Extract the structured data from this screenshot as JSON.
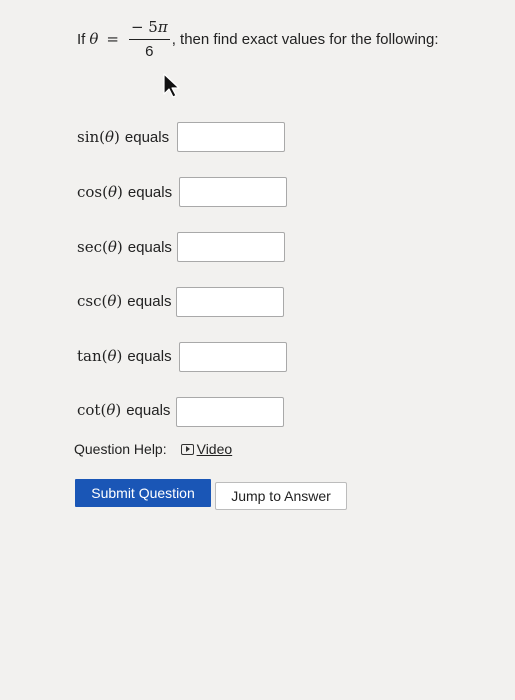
{
  "question": {
    "prefix": "If",
    "variable": "θ",
    "equals": "=",
    "numerator": "− 5",
    "numerator_pi": "π",
    "denominator": "6",
    "suffix": ", then find exact values for the following:"
  },
  "rows": [
    {
      "fn": "sin",
      "arg": "θ",
      "label": "equals",
      "value": ""
    },
    {
      "fn": "cos",
      "arg": "θ",
      "label": "equals",
      "value": ""
    },
    {
      "fn": "sec",
      "arg": "θ",
      "label": "equals",
      "value": ""
    },
    {
      "fn": "csc",
      "arg": "θ",
      "label": "equals",
      "value": ""
    },
    {
      "fn": "tan",
      "arg": "θ",
      "label": "equals",
      "value": ""
    },
    {
      "fn": "cot",
      "arg": "θ",
      "label": "equals",
      "value": ""
    }
  ],
  "help": {
    "label": "Question Help:",
    "video_icon": "video-icon",
    "video_label": "Video"
  },
  "buttons": {
    "submit": "Submit Question",
    "jump": "Jump to Answer"
  },
  "cursor_icon": "mouse-pointer-icon"
}
